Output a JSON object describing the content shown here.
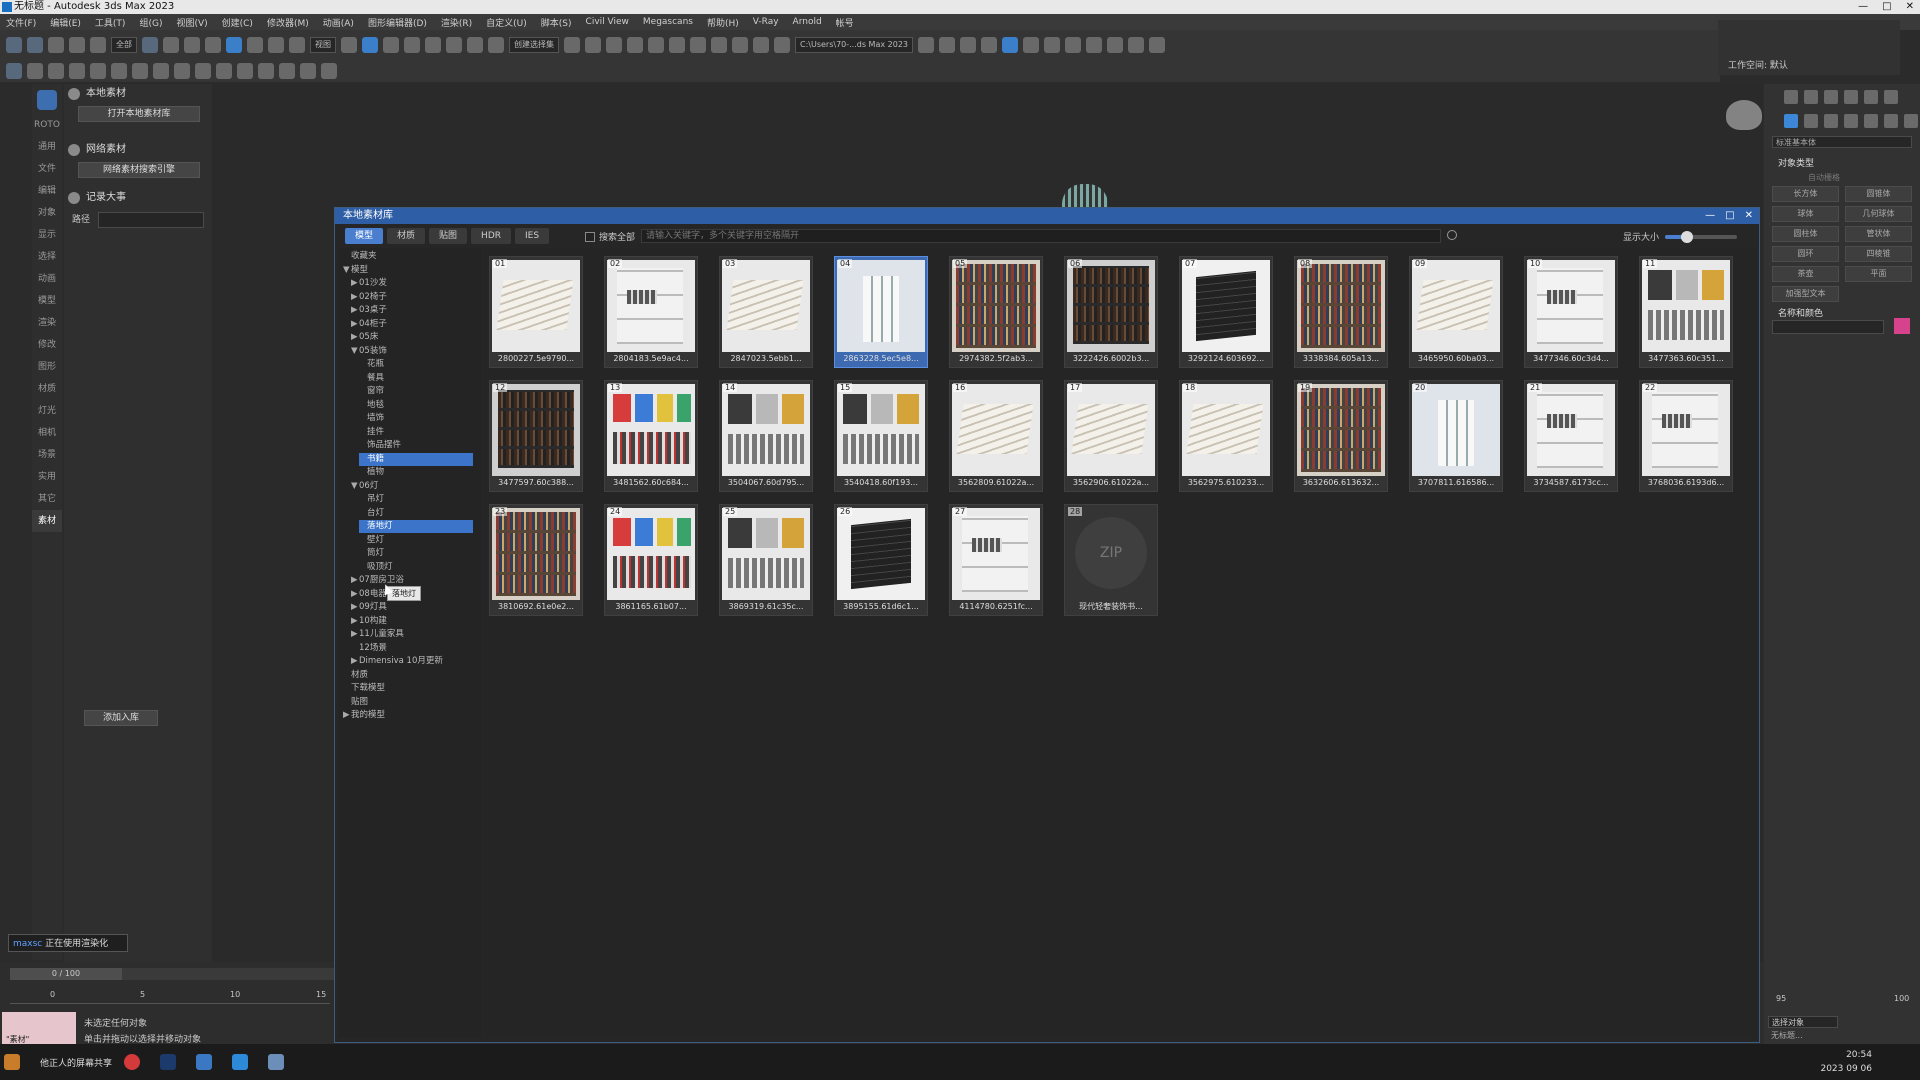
{
  "window": {
    "title": "无标题 - Autodesk 3ds Max 2023",
    "controls": [
      "—",
      "□",
      "✕"
    ]
  },
  "menubar": [
    "文件(F)",
    "编辑(E)",
    "工具(T)",
    "组(G)",
    "视图(V)",
    "创建(C)",
    "修改器(M)",
    "动画(A)",
    "图形编辑器(D)",
    "渲染(R)",
    "自定义(U)",
    "脚本(S)",
    "Civil View",
    "Megascans",
    "帮助(H)",
    "V-Ray",
    "Arnold",
    "帐号"
  ],
  "toolbar": {
    "selection_filter": "全部",
    "view_select": "视图",
    "named_selection": "创建选择集",
    "project_path": "C:\\Users\\70-...ds Max 2023"
  },
  "mini_panel": {
    "label": "工作空间: 默认"
  },
  "left_strip": [
    "ROTO",
    "通用",
    "文件",
    "编辑",
    "对象",
    "显示",
    "选择",
    "动画",
    "模型",
    "渲染",
    "修改",
    "图形",
    "材质",
    "灯光",
    "相机",
    "场景",
    "实用",
    "其它",
    "素材"
  ],
  "mat_panel": {
    "local_header": "本地素材",
    "open_local": "打开本地素材库",
    "net_header": "网络素材",
    "open_net": "网络素材搜索引擎",
    "record_header": "记录大事",
    "path_label": "路径",
    "import_button": "添加入库"
  },
  "script_line": {
    "prefix": "maxsc",
    "text": "正在使用渲染化"
  },
  "timeline": {
    "frame": "0 / 100",
    "ticks": [
      "0",
      "5",
      "10",
      "15"
    ]
  },
  "status": {
    "line1": "未选定任何对象",
    "line2": "单击并拖动以选择并移动对象",
    "swatch_text": "\"素材\""
  },
  "dialog": {
    "title": "本地素材库",
    "tabs": [
      "模型",
      "材质",
      "贴图",
      "HDR",
      "IES"
    ],
    "active_tab": 0,
    "search_all": "搜索全部",
    "search_placeholder": "请输入关键字，多个关键字用空格隔开",
    "size_label": "显示大小",
    "size_value": 0.3,
    "tree": [
      {
        "label": "收藏夹",
        "indent": 0,
        "arrow": ""
      },
      {
        "label": "模型",
        "indent": 0,
        "arrow": "▼"
      },
      {
        "label": "01沙发",
        "indent": 1,
        "arrow": "▶"
      },
      {
        "label": "02椅子",
        "indent": 1,
        "arrow": "▶"
      },
      {
        "label": "03桌子",
        "indent": 1,
        "arrow": "▶"
      },
      {
        "label": "04柜子",
        "indent": 1,
        "arrow": "▶"
      },
      {
        "label": "05床",
        "indent": 1,
        "arrow": "▶"
      },
      {
        "label": "05装饰",
        "indent": 1,
        "arrow": "▼"
      },
      {
        "label": "花瓶",
        "indent": 2,
        "arrow": ""
      },
      {
        "label": "餐具",
        "indent": 2,
        "arrow": ""
      },
      {
        "label": "窗帘",
        "indent": 2,
        "arrow": ""
      },
      {
        "label": "地毯",
        "indent": 2,
        "arrow": ""
      },
      {
        "label": "墙饰",
        "indent": 2,
        "arrow": ""
      },
      {
        "label": "挂件",
        "indent": 2,
        "arrow": ""
      },
      {
        "label": "饰品摆件",
        "indent": 2,
        "arrow": ""
      },
      {
        "label": "书籍",
        "indent": 2,
        "arrow": "",
        "selected": true
      },
      {
        "label": "植物",
        "indent": 2,
        "arrow": ""
      },
      {
        "label": "06灯",
        "indent": 1,
        "arrow": "▼"
      },
      {
        "label": "吊灯",
        "indent": 2,
        "arrow": ""
      },
      {
        "label": "台灯",
        "indent": 2,
        "arrow": ""
      },
      {
        "label": "落地灯",
        "indent": 2,
        "arrow": "",
        "selected": true
      },
      {
        "label": "壁灯",
        "indent": 2,
        "arrow": ""
      },
      {
        "label": "筒灯",
        "indent": 2,
        "arrow": ""
      },
      {
        "label": "吸顶灯",
        "indent": 2,
        "arrow": ""
      },
      {
        "label": "07厨房卫浴",
        "indent": 1,
        "arrow": "▶"
      },
      {
        "label": "08电器",
        "indent": 1,
        "arrow": "▶"
      },
      {
        "label": "09灯具",
        "indent": 1,
        "arrow": "▶"
      },
      {
        "label": "10构建",
        "indent": 1,
        "arrow": "▶"
      },
      {
        "label": "11儿童家具",
        "indent": 1,
        "arrow": "▶"
      },
      {
        "label": "12场景",
        "indent": 1,
        "arrow": ""
      },
      {
        "label": "Dimensiva 10月更新",
        "indent": 1,
        "arrow": "▶"
      },
      {
        "label": "材质",
        "indent": 0,
        "arrow": ""
      },
      {
        "label": "下载模型",
        "indent": 0,
        "arrow": ""
      },
      {
        "label": "贴图",
        "indent": 0,
        "arrow": ""
      },
      {
        "label": "我的模型",
        "indent": 0,
        "arrow": "▶"
      }
    ],
    "tooltip": "落地灯",
    "items": [
      {
        "num": "01",
        "name": "2800227.5e9790...",
        "kind": "book"
      },
      {
        "num": "02",
        "name": "2804183.5e9ac4...",
        "kind": "shelf"
      },
      {
        "num": "03",
        "name": "2847023.5ebb1...",
        "kind": "book"
      },
      {
        "num": "04",
        "name": "2863228.5ec5e8...",
        "kind": "white",
        "selected": true
      },
      {
        "num": "05",
        "name": "2974382.5f2ab3...",
        "kind": "bookcase"
      },
      {
        "num": "06",
        "name": "3222426.6002b3...",
        "kind": "dark"
      },
      {
        "num": "07",
        "name": "3292124.603692...",
        "kind": "black"
      },
      {
        "num": "08",
        "name": "3338384.605a13...",
        "kind": "bookcase"
      },
      {
        "num": "09",
        "name": "3465950.60ba03...",
        "kind": "book"
      },
      {
        "num": "10",
        "name": "3477346.60c3d4...",
        "kind": "shelf"
      },
      {
        "num": "11",
        "name": "3477363.60c351...",
        "kind": "poster"
      },
      {
        "num": "12",
        "name": "3477597.60c388...",
        "kind": "dark"
      },
      {
        "num": "13",
        "name": "3481562.60c684...",
        "kind": "color"
      },
      {
        "num": "14",
        "name": "3504067.60d795...",
        "kind": "poster"
      },
      {
        "num": "15",
        "name": "3540418.60f193...",
        "kind": "poster"
      },
      {
        "num": "16",
        "name": "3562809.61022a...",
        "kind": "book"
      },
      {
        "num": "17",
        "name": "3562906.61022a...",
        "kind": "book"
      },
      {
        "num": "18",
        "name": "3562975.610233...",
        "kind": "book"
      },
      {
        "num": "19",
        "name": "3632606.613632...",
        "kind": "bookcase"
      },
      {
        "num": "20",
        "name": "3707811.616586...",
        "kind": "white"
      },
      {
        "num": "21",
        "name": "3734587.6173cc...",
        "kind": "shelf"
      },
      {
        "num": "22",
        "name": "3768036.6193d6...",
        "kind": "shelf"
      },
      {
        "num": "23",
        "name": "3810692.61e0e2...",
        "kind": "bookcase"
      },
      {
        "num": "24",
        "name": "3861165.61b07...",
        "kind": "color"
      },
      {
        "num": "25",
        "name": "3869319.61c35c...",
        "kind": "poster"
      },
      {
        "num": "26",
        "name": "3895155.61d6c1...",
        "kind": "black"
      },
      {
        "num": "27",
        "name": "4114780.6251fc...",
        "kind": "shelf"
      },
      {
        "num": "28",
        "name": "现代轻奢装饰书...",
        "kind": "zip"
      }
    ],
    "zip_label": "ZIP"
  },
  "cmd_panel": {
    "category": "标准基本体",
    "section_object_type": "对象类型",
    "auto_grid": "自动栅格",
    "buttons": [
      "长方体",
      "圆锥体",
      "球体",
      "几何球体",
      "圆柱体",
      "管状体",
      "圆环",
      "四棱锥",
      "茶壶",
      "平面",
      "加强型文本"
    ],
    "section_name_color": "名称和颜色",
    "accent_color": "#d6428c",
    "ruler": [
      "95",
      "100"
    ],
    "bottom_select": "选择对象",
    "bottom_text": "无标题..."
  },
  "taskbar": {
    "share_text": "他正人的屏幕共享",
    "time": "20:54",
    "date": "2023 09 06"
  }
}
